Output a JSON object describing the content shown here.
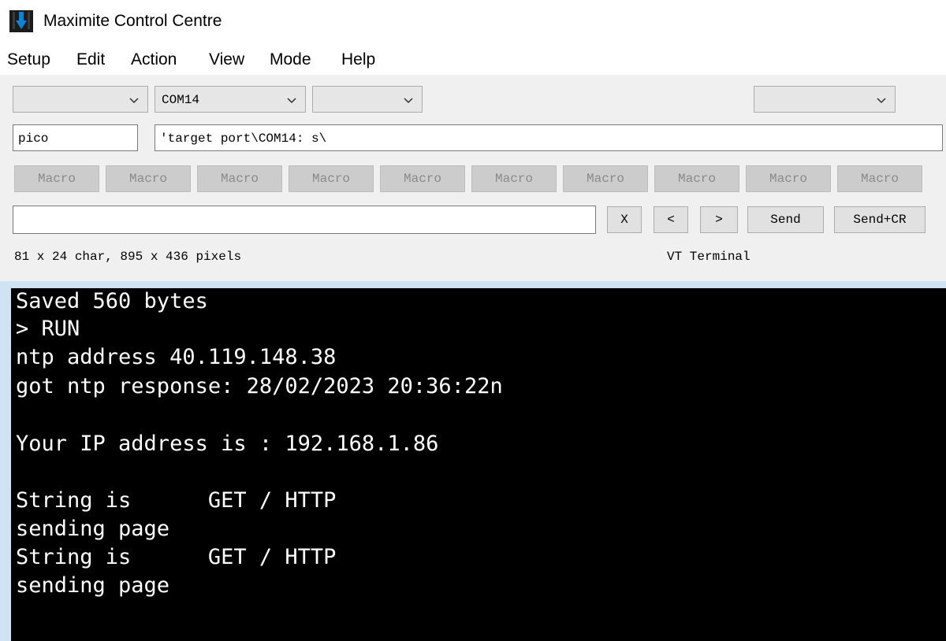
{
  "window": {
    "title": "Maximite Control Centre"
  },
  "menu": [
    "Setup",
    "Edit",
    "Action",
    "View",
    "Mode",
    "Help"
  ],
  "toolbar": {
    "combo1_value": "",
    "port_value": "COM14",
    "combo3_value": "",
    "combo4_value": "",
    "device_name": "pico",
    "target_port_text": "'target port\\COM14: s\\",
    "macros": [
      "Macro",
      "Macro",
      "Macro",
      "Macro",
      "Macro",
      "Macro",
      "Macro",
      "Macro",
      "Macro",
      "Macro"
    ],
    "command_value": "",
    "clear_label": "X",
    "prev_label": "<",
    "next_label": ">",
    "send_label": "Send",
    "send_cr_label": "Send+CR",
    "status_dimensions": "81 x 24 char, 895 x 436 pixels",
    "status_mode": "VT Terminal"
  },
  "terminal": {
    "lines": [
      "Saved 560 bytes",
      "> RUN",
      "ntp address 40.119.148.38",
      "got ntp response: 28/02/2023 20:36:22n",
      "",
      "Your IP address is : 192.168.1.86",
      "",
      "String is      GET / HTTP",
      "sending page",
      "String is      GET / HTTP",
      "sending page"
    ]
  },
  "colors": {
    "terminal_bg": "#000000",
    "terminal_fg": "#ffffff",
    "toolbar_bg": "#f0f0f0",
    "macro_disabled_bg": "#cccccc"
  },
  "icons": [
    "app-icon",
    "chevron-down-icon"
  ]
}
